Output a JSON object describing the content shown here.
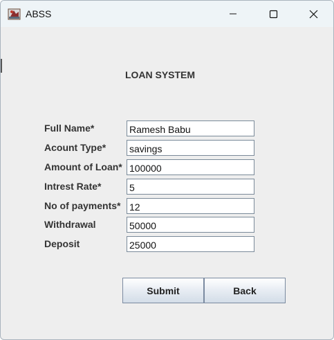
{
  "window": {
    "title": "ABSS",
    "icon": "app-icon",
    "controls": {
      "minimize_icon": "minimize-icon",
      "maximize_icon": "maximize-icon",
      "close_icon": "close-icon"
    }
  },
  "heading": "LOAN SYSTEM",
  "form": {
    "fields": [
      {
        "label": "Full Name*",
        "value": "Ramesh Babu"
      },
      {
        "label": "Acount Type*",
        "value": "savings"
      },
      {
        "label": "Amount of Loan*",
        "value": "100000"
      },
      {
        "label": "Intrest Rate*",
        "value": "5"
      },
      {
        "label": "No of payments*",
        "value": "12"
      },
      {
        "label": "Withdrawal",
        "value": "50000"
      },
      {
        "label": "Deposit",
        "value": "25000"
      }
    ]
  },
  "buttons": {
    "submit": "Submit",
    "back": "Back"
  },
  "colors": {
    "window_bg": "#eeeeee",
    "titlebar_bg": "#eef4f7",
    "label_text": "#333333",
    "button_border": "#7a8aa0"
  }
}
